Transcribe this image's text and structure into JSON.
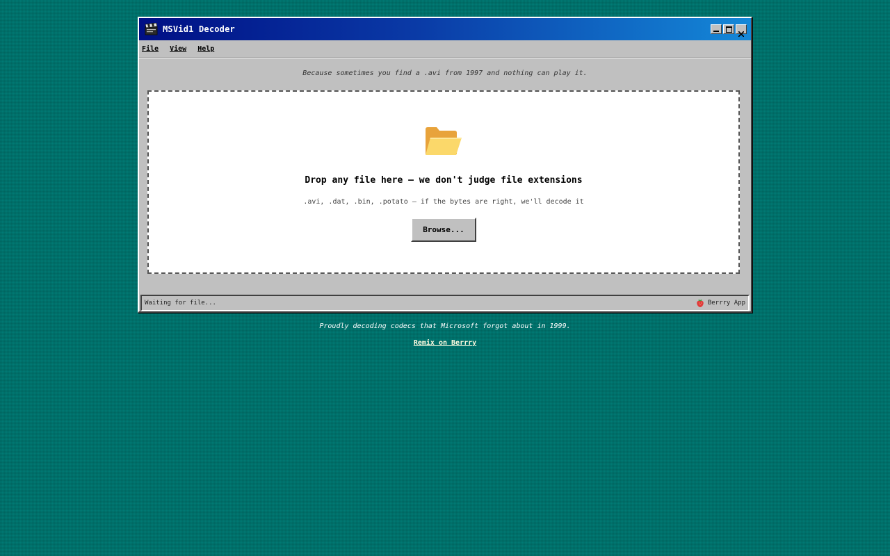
{
  "window": {
    "title": "MSVid1 Decoder",
    "icon": "clapperboard-icon",
    "controls": {
      "minimize": "minimize-icon",
      "maximize": "maximize-icon",
      "close": "close-icon"
    }
  },
  "menu": {
    "items": [
      {
        "label": "File"
      },
      {
        "label": "View"
      },
      {
        "label": "Help"
      }
    ]
  },
  "tagline": "Because sometimes you find a .avi from 1997 and nothing can play it.",
  "dropzone": {
    "icon": "open-folder-icon",
    "title": "Drop any file here — we don't judge file extensions",
    "subtitle": ".avi, .dat, .bin, .potato — if the bytes are right, we'll decode it",
    "browse_label": "Browse..."
  },
  "status": {
    "left": "Waiting for file...",
    "right_icon": "strawberry-icon",
    "right": "Berrry App"
  },
  "footer": {
    "text": "Proudly decoding codecs that Microsoft forgot about in 1999.",
    "link": "Remix on Berrry"
  },
  "colors": {
    "desktop": "#007a74",
    "titlebar_start": "#000f85",
    "titlebar_end": "#1488d8",
    "window_face": "#c0c0c0"
  }
}
